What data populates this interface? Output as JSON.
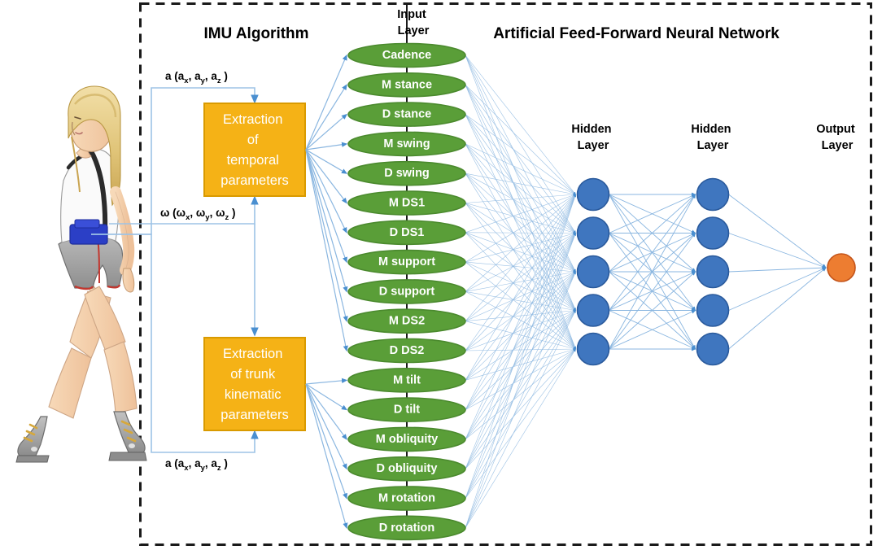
{
  "figure": {
    "border_style": "dashed",
    "border_color": "#1a1a1a"
  },
  "headings": {
    "imu_algorithm": "IMU Algorithm",
    "network": "Artificial Feed-Forward Neural Network"
  },
  "layer_labels": {
    "input_line1": "Input",
    "input_line2": "Layer",
    "hidden1_line1": "Hidden",
    "hidden1_line2": "Layer",
    "hidden2_line1": "Hidden",
    "hidden2_line2": "Layer",
    "output_line1": "Output",
    "output_line2": "Layer"
  },
  "subject": {
    "name": "walking-person-with-imu-sensor",
    "sensor_color": "#2b3fc6"
  },
  "signals": [
    {
      "id": "accel-top",
      "symbol": "a",
      "components": [
        "a",
        "a",
        "a"
      ],
      "subscripts": [
        "x",
        "y",
        "z"
      ],
      "text": "a (ax, ay, az )"
    },
    {
      "id": "gyro-mid",
      "symbol": "ω",
      "components": [
        "ω",
        "ω",
        "ω"
      ],
      "subscripts": [
        "x",
        "y",
        "z"
      ],
      "text": "ω (ωx, ωy, ωz )"
    },
    {
      "id": "accel-bottom",
      "symbol": "a",
      "components": [
        "a",
        "a",
        "a"
      ],
      "subscripts": [
        "x",
        "y",
        "z"
      ],
      "text": "a (ax, ay, az )"
    }
  ],
  "processing_boxes": [
    {
      "id": "temporal",
      "lines": [
        "Extraction",
        "of",
        "temporal",
        "parameters"
      ],
      "fill": "#f5b216",
      "stroke": "#d99a00"
    },
    {
      "id": "trunk",
      "lines": [
        "Extraction",
        "of trunk",
        "kinematic",
        "parameters"
      ],
      "fill": "#f5b216",
      "stroke": "#d99a00"
    }
  ],
  "input_nodes": [
    {
      "label": "Cadence",
      "source": "temporal"
    },
    {
      "label": "M stance",
      "source": "temporal"
    },
    {
      "label": "D stance",
      "source": "temporal"
    },
    {
      "label": "M swing",
      "source": "temporal"
    },
    {
      "label": "D swing",
      "source": "temporal"
    },
    {
      "label": "M DS1",
      "source": "temporal"
    },
    {
      "label": "D DS1",
      "source": "temporal"
    },
    {
      "label": "M support",
      "source": "temporal"
    },
    {
      "label": "D support",
      "source": "temporal"
    },
    {
      "label": "M DS2",
      "source": "temporal"
    },
    {
      "label": "D DS2",
      "source": "temporal"
    },
    {
      "label": "M tilt",
      "source": "trunk"
    },
    {
      "label": "D tilt",
      "source": "trunk"
    },
    {
      "label": "M obliquity",
      "source": "trunk"
    },
    {
      "label": "D obliquity",
      "source": "trunk"
    },
    {
      "label": "M rotation",
      "source": "trunk"
    },
    {
      "label": "D rotation",
      "source": "trunk"
    }
  ],
  "node_style": {
    "input_fill": "#5a9e38",
    "input_stroke": "#4b8a2e",
    "hidden_fill": "#3f76bf",
    "hidden_stroke": "#2a5a9c",
    "output_fill": "#ed7d31",
    "output_stroke": "#c4541a",
    "edge_color": "#8ab6e0"
  },
  "hidden_layer_1": {
    "count": 5
  },
  "hidden_layer_2": {
    "count": 5
  },
  "output_layer": {
    "count": 1
  }
}
